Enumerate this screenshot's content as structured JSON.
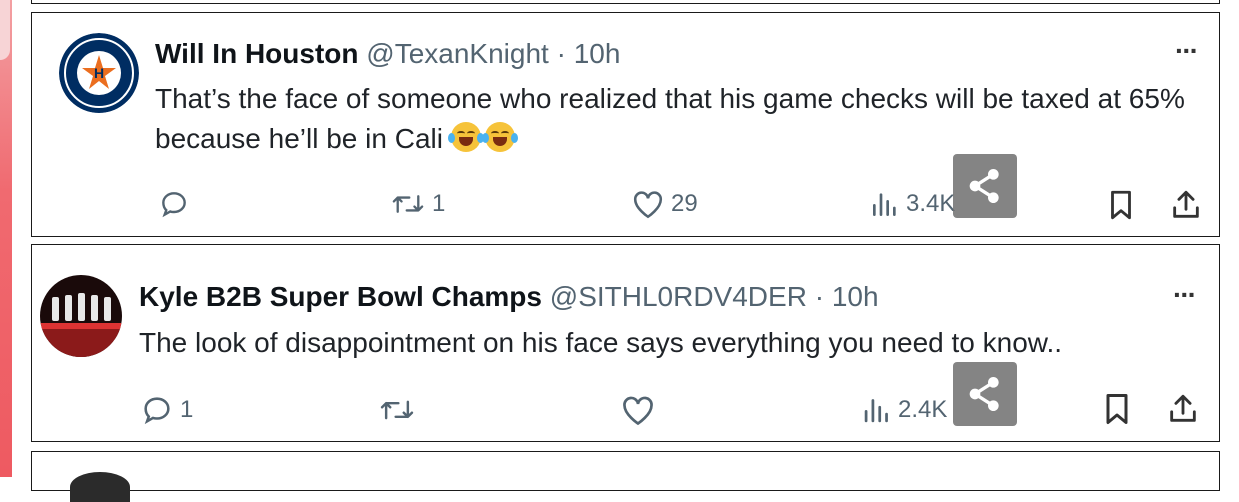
{
  "tweets": [
    {
      "display_name": "Will In Houston",
      "handle": "@TexanKnight",
      "separator": "·",
      "time": "10h",
      "text": "That’s the face of someone who realized that his game checks will be taxed at 65% because he’ll be in Cali",
      "emojis": [
        "face-with-tears-of-joy",
        "face-with-tears-of-joy"
      ],
      "avatar": "houston-astros-logo",
      "actions": {
        "reply": "",
        "repost": "1",
        "like": "29",
        "views": "3.4K"
      }
    },
    {
      "display_name": "Kyle B2B Super Bowl Champs",
      "handle": "@SITHL0RDV4DER",
      "separator": "·",
      "time": "10h",
      "text": "The look of disappointment on his face says everything you need to know..",
      "avatar": "trophies-avatar",
      "actions": {
        "reply": "1",
        "repost": "",
        "like": "",
        "views": "2.4K"
      }
    }
  ],
  "more_icon": "···",
  "colors": {
    "text": "#0f1419",
    "secondary": "#536471",
    "card_border": "#1a1a1a",
    "share_overlay": "#6e6e6e",
    "left_strip": "#ee5a61"
  }
}
